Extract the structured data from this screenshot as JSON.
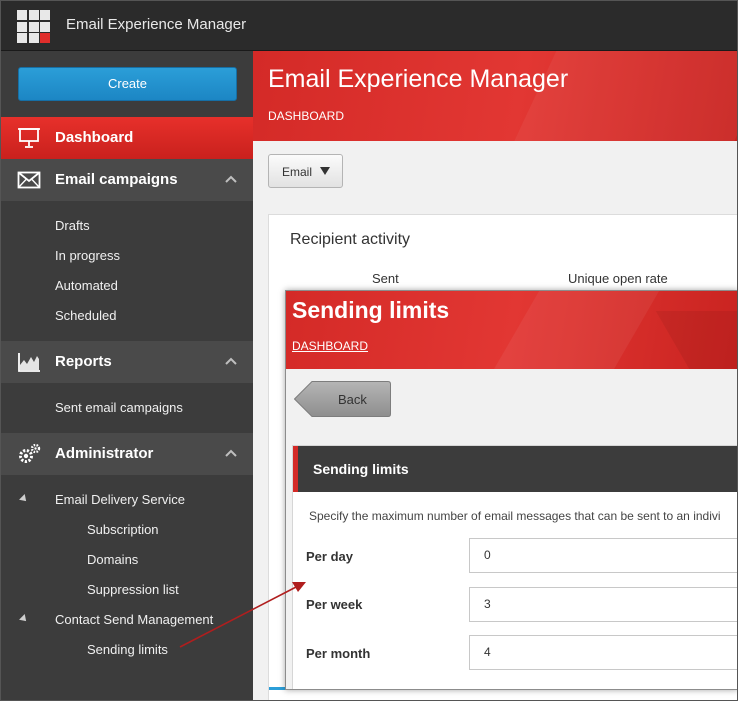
{
  "topbar": {
    "title": "Email Experience Manager"
  },
  "sidebar": {
    "create_label": "Create",
    "dashboard": {
      "label": "Dashboard",
      "icon": "presentation-board-icon"
    },
    "email_campaigns": {
      "label": "Email campaigns",
      "icon": "envelope-icon",
      "items": [
        "Drafts",
        "In progress",
        "Automated",
        "Scheduled"
      ]
    },
    "reports": {
      "label": "Reports",
      "icon": "chart-icon",
      "items": [
        "Sent email campaigns"
      ]
    },
    "administrator": {
      "label": "Administrator",
      "icon": "gears-icon",
      "email_delivery": "Email Delivery Service",
      "email_delivery_items": [
        "Subscription",
        "Domains",
        "Suppression list"
      ],
      "contact_send": "Contact Send Management",
      "contact_send_items": [
        "Sending limits"
      ]
    }
  },
  "main": {
    "title": "Email Experience Manager",
    "breadcrumb": "DASHBOARD",
    "filter_value": "Email",
    "card_title": "Recipient activity",
    "columns": [
      "Sent",
      "Unique open rate"
    ]
  },
  "sending_limits": {
    "title": "Sending limits",
    "breadcrumb": "DASHBOARD",
    "back_label": "Back",
    "section_title": "Sending limits",
    "description": "Specify the maximum number of email messages that can be sent to an indivi",
    "fields": [
      {
        "label": "Per day",
        "value": "0"
      },
      {
        "label": "Per week",
        "value": "3"
      },
      {
        "label": "Per month",
        "value": "4"
      }
    ]
  },
  "colors": {
    "accent_red": "#d42a27",
    "create_blue": "#1c86c4",
    "sidebar_bg": "#3c3c3c",
    "arrow": "#b01e1e"
  }
}
